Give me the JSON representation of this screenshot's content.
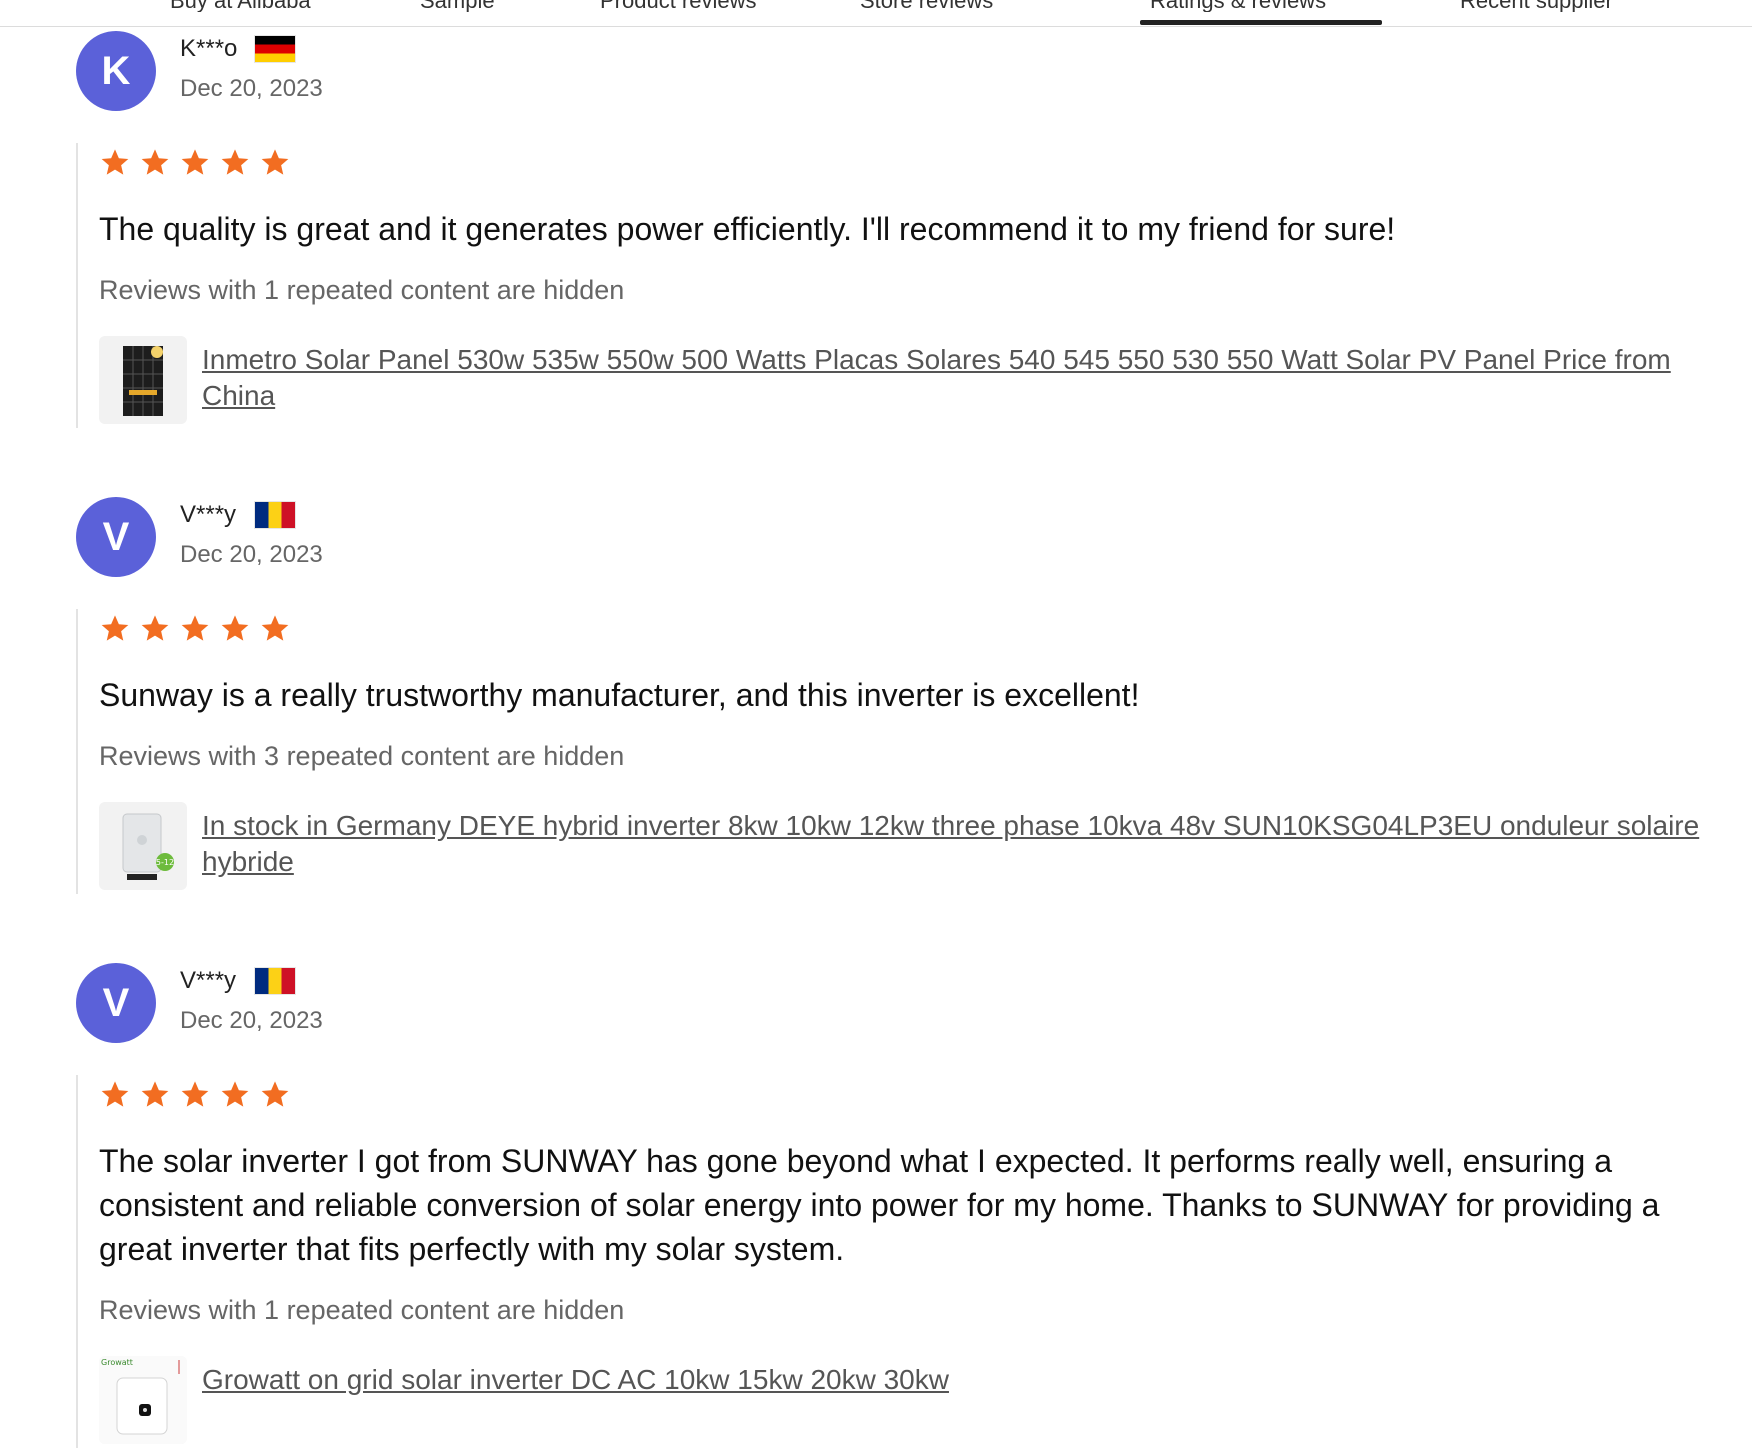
{
  "tabs": [
    {
      "label": "Buy at Alibaba"
    },
    {
      "label": "Sample"
    },
    {
      "label": "Product reviews"
    },
    {
      "label": "Store reviews"
    },
    {
      "label": "Ratings & reviews"
    },
    {
      "label": "Recent supplier"
    }
  ],
  "reviews": [
    {
      "avatar_letter": "K",
      "name": "K***o",
      "country_flag": "Germany",
      "date": "Dec 20, 2023",
      "rating": 5,
      "text": "The quality is great and it generates power efficiently. I'll recommend it to my friend for sure!",
      "hidden_note": "Reviews with 1 repeated content are hidden",
      "product_title": "Inmetro Solar Panel 530w 535w 550w 500 Watts Placas Solares 540 545 550 530 550 Watt Solar PV Panel Price from China",
      "thumb_icon": "solar-panel-thumbnail"
    },
    {
      "avatar_letter": "V",
      "name": "V***y",
      "country_flag": "Romania",
      "date": "Dec 20, 2023",
      "rating": 5,
      "text": "Sunway is a really trustworthy manufacturer, and this inverter is excellent!",
      "hidden_note": "Reviews with 3 repeated content are hidden",
      "product_title": "In stock in Germany DEYE hybrid inverter 8kw 10kw 12kw three phase 10kva 48v SUN10KSG04LP3EU onduleur solaire hybride",
      "thumb_icon": "hybrid-inverter-thumbnail"
    },
    {
      "avatar_letter": "V",
      "name": "V***y",
      "country_flag": "Romania",
      "date": "Dec 20, 2023",
      "rating": 5,
      "text": "The solar inverter I got from SUNWAY has gone beyond what I expected. It performs really well, ensuring a consistent and reliable conversion of solar energy into power for my home. Thanks to SUNWAY for providing a great inverter that fits perfectly with my solar system.",
      "hidden_note": "Reviews with 1 repeated content are hidden",
      "product_title": "Growatt on grid solar inverter DC AC 10kw 15kw 20kw 30kw",
      "thumb_icon": "grid-inverter-thumbnail"
    }
  ],
  "colors": {
    "avatar": "#5b61d9",
    "star": "#f26d21",
    "tab_active": "#222222"
  }
}
